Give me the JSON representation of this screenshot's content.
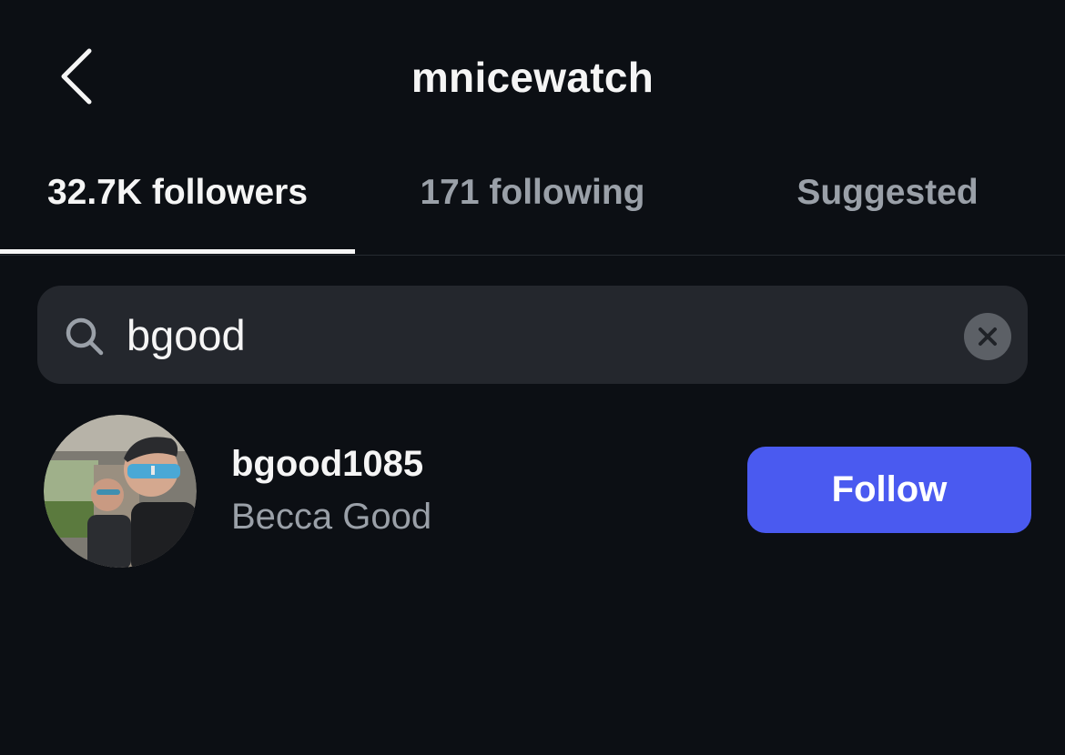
{
  "header": {
    "title": "mnicewatch",
    "back_icon": "chevron-left-icon"
  },
  "tabs": [
    {
      "label": "32.7K followers",
      "active": true
    },
    {
      "label": "171 following",
      "active": false
    },
    {
      "label": "Suggested",
      "active": false
    }
  ],
  "search": {
    "icon": "search-icon",
    "value": "bgood",
    "clear_icon": "clear-icon"
  },
  "results": [
    {
      "username": "bgood1085",
      "full_name": "Becca Good",
      "follow_label": "Follow"
    }
  ],
  "colors": {
    "background": "#0c0f14",
    "search_bg": "#24272d",
    "primary_text": "#f5f5f5",
    "secondary_text": "#9aa0a8",
    "follow_button": "#4a5af0"
  }
}
